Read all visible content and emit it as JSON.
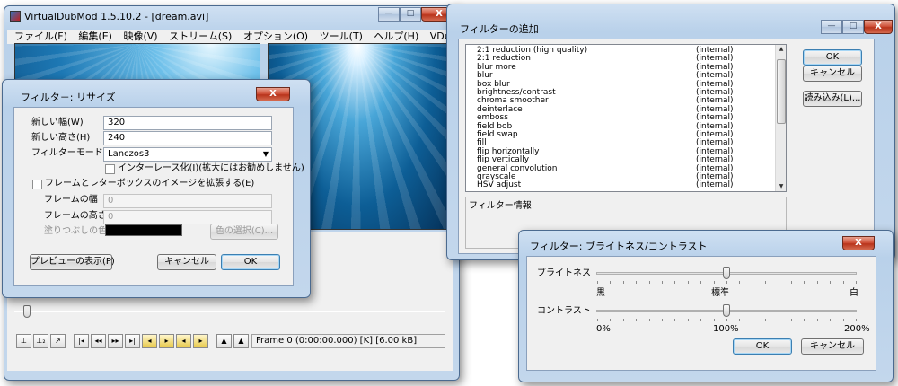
{
  "main_window": {
    "title": "VirtualDubMod 1.5.10.2 - [dream.avi]",
    "menu": [
      "ファイル(F)",
      "編集(E)",
      "映像(V)",
      "ストリーム(S)",
      "オプション(O)",
      "ツール(T)",
      "ヘルプ(H)",
      "VDubAuo"
    ],
    "status": "Frame 0 (0:00:00.000) [K] [6.00 kB]"
  },
  "resize_dialog": {
    "title": "フィルタ－: リサイズ",
    "close_label": "X",
    "new_width_label": "新しい幅(W)",
    "new_width_value": "320",
    "new_height_label": "新しい高さ(H)",
    "new_height_value": "240",
    "filter_mode_label": "フィルターモード(M)",
    "filter_mode_value": "Lanczos3",
    "interlace_label": "インターレース化(I)(拡大にはお勧めしません)",
    "expand_label": "フレームとレターボックスのイメージを拡張する(E)",
    "frame_width_label": "フレームの幅",
    "frame_width_value": "0",
    "frame_height_label": "フレームの高さ",
    "frame_height_value": "0",
    "fill_color_label": "塗りつぶしの色",
    "fill_color": "#000000",
    "color_select_label": "色の選択(C)...",
    "preview_label": "プレビューの表示(P)",
    "cancel_label": "キャンセル",
    "ok_label": "OK"
  },
  "filter_dialog": {
    "title": "フィルターの追加",
    "filters": [
      {
        "name": "2:1 reduction (high quality)",
        "tag": "(internal)"
      },
      {
        "name": "2:1 reduction",
        "tag": "(internal)"
      },
      {
        "name": "blur more",
        "tag": "(internal)"
      },
      {
        "name": "blur",
        "tag": "(internal)"
      },
      {
        "name": "box blur",
        "tag": "(internal)"
      },
      {
        "name": "brightness/contrast",
        "tag": "(internal)"
      },
      {
        "name": "chroma smoother",
        "tag": "(internal)"
      },
      {
        "name": "deinterlace",
        "tag": "(internal)"
      },
      {
        "name": "emboss",
        "tag": "(internal)"
      },
      {
        "name": "field bob",
        "tag": "(internal)"
      },
      {
        "name": "field swap",
        "tag": "(internal)"
      },
      {
        "name": "fill",
        "tag": "(internal)"
      },
      {
        "name": "flip horizontally",
        "tag": "(internal)"
      },
      {
        "name": "flip vertically",
        "tag": "(internal)"
      },
      {
        "name": "general convolution",
        "tag": "(internal)"
      },
      {
        "name": "grayscale",
        "tag": "(internal)"
      },
      {
        "name": "HSV adjust",
        "tag": "(internal)"
      }
    ],
    "info_label": "フィルター情報",
    "ok_label": "OK",
    "cancel_label": "キャンセル",
    "load_label": "読み込み(L)..."
  },
  "brightness_dialog": {
    "title": "フィルター: ブライトネス/コントラスト",
    "brightness_label": "ブライトネス",
    "brightness_min": "黒",
    "brightness_mid": "標準",
    "brightness_max": "白",
    "brightness_level": 0.5,
    "contrast_label": "コントラスト",
    "contrast_min": "0%",
    "contrast_mid": "100%",
    "contrast_max": "200%",
    "contrast_level": 0.5,
    "ok_label": "OK",
    "cancel_label": "キャンセル"
  }
}
